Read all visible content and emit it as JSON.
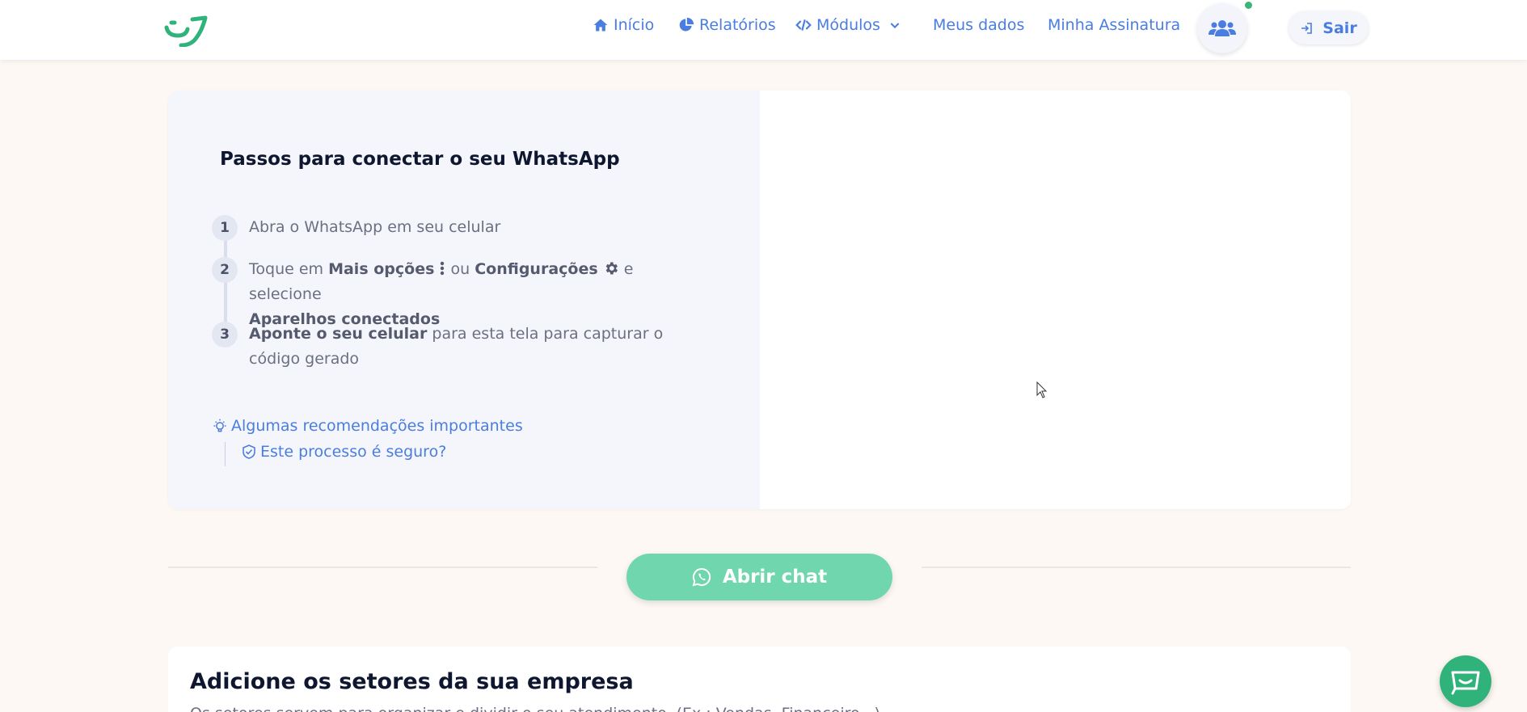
{
  "nav": {
    "inicio": "Início",
    "relatorios": "Relatórios",
    "modulos": "Módulos",
    "meus_dados": "Meus dados",
    "assinatura": "Minha Assinatura",
    "sair": "Sair"
  },
  "steps": {
    "title": "Passos para conectar o seu WhatsApp",
    "items": [
      {
        "number": "1",
        "text": "Abra o WhatsApp em seu celular"
      },
      {
        "number": "2",
        "prefix": "Toque em ",
        "bold1": "Mais opções",
        "middle": " ou ",
        "bold2": "Configurações",
        "suffix": " e selecione ",
        "bold3": "Aparelhos conectados"
      },
      {
        "number": "3",
        "bold1": "Aponte o seu celular",
        "suffix": " para esta tela para capturar o código gerado"
      }
    ],
    "recommendations": "Algumas recomendações importantes",
    "secure": "Este processo é seguro?"
  },
  "chat": {
    "label": "Abrir chat"
  },
  "sectors": {
    "title": "Adicione os setores da sua empresa",
    "description": "Os setores servem para organizar e dividir o seu atendimento. (Ex.: Vendas, Financeiro...)"
  },
  "colors": {
    "brand_green": "#2fb37a",
    "nav_blue": "#4a7de0",
    "chat_button": "#6fd6ae",
    "page_bg": "#fdf8f3"
  },
  "icons": [
    "home-icon",
    "pie-chart-icon",
    "code-icon",
    "chevron-down-icon",
    "users-icon",
    "logout-icon",
    "more-vertical-icon",
    "gear-icon",
    "lightbulb-icon",
    "shield-check-icon",
    "whatsapp-icon",
    "support-chat-icon"
  ]
}
